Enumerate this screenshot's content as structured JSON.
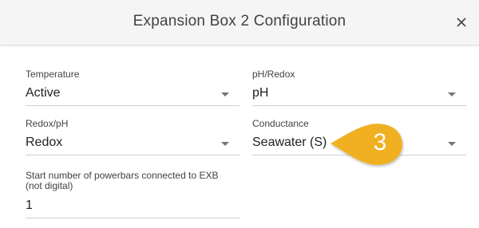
{
  "dialog": {
    "title": "Expansion Box 2 Configuration",
    "close_icon": "close-icon"
  },
  "fields": {
    "temperature": {
      "label": "Temperature",
      "value": "Active"
    },
    "ph_redox": {
      "label": "pH/Redox",
      "value": "pH"
    },
    "redox_ph": {
      "label": "Redox/pH",
      "value": "Redox"
    },
    "conductance": {
      "label": "Conductance",
      "value": "Seawater (S)"
    },
    "powerbars": {
      "label_line1": "Start number of powerbars connected to EXB",
      "label_line2": "(not digital)",
      "value": "1"
    }
  },
  "callout": {
    "number": "3",
    "color": "#f0b020"
  },
  "colors": {
    "header_bg": "#f5f5f5",
    "underline": "#cfcfcf",
    "arrow": "#757575"
  }
}
